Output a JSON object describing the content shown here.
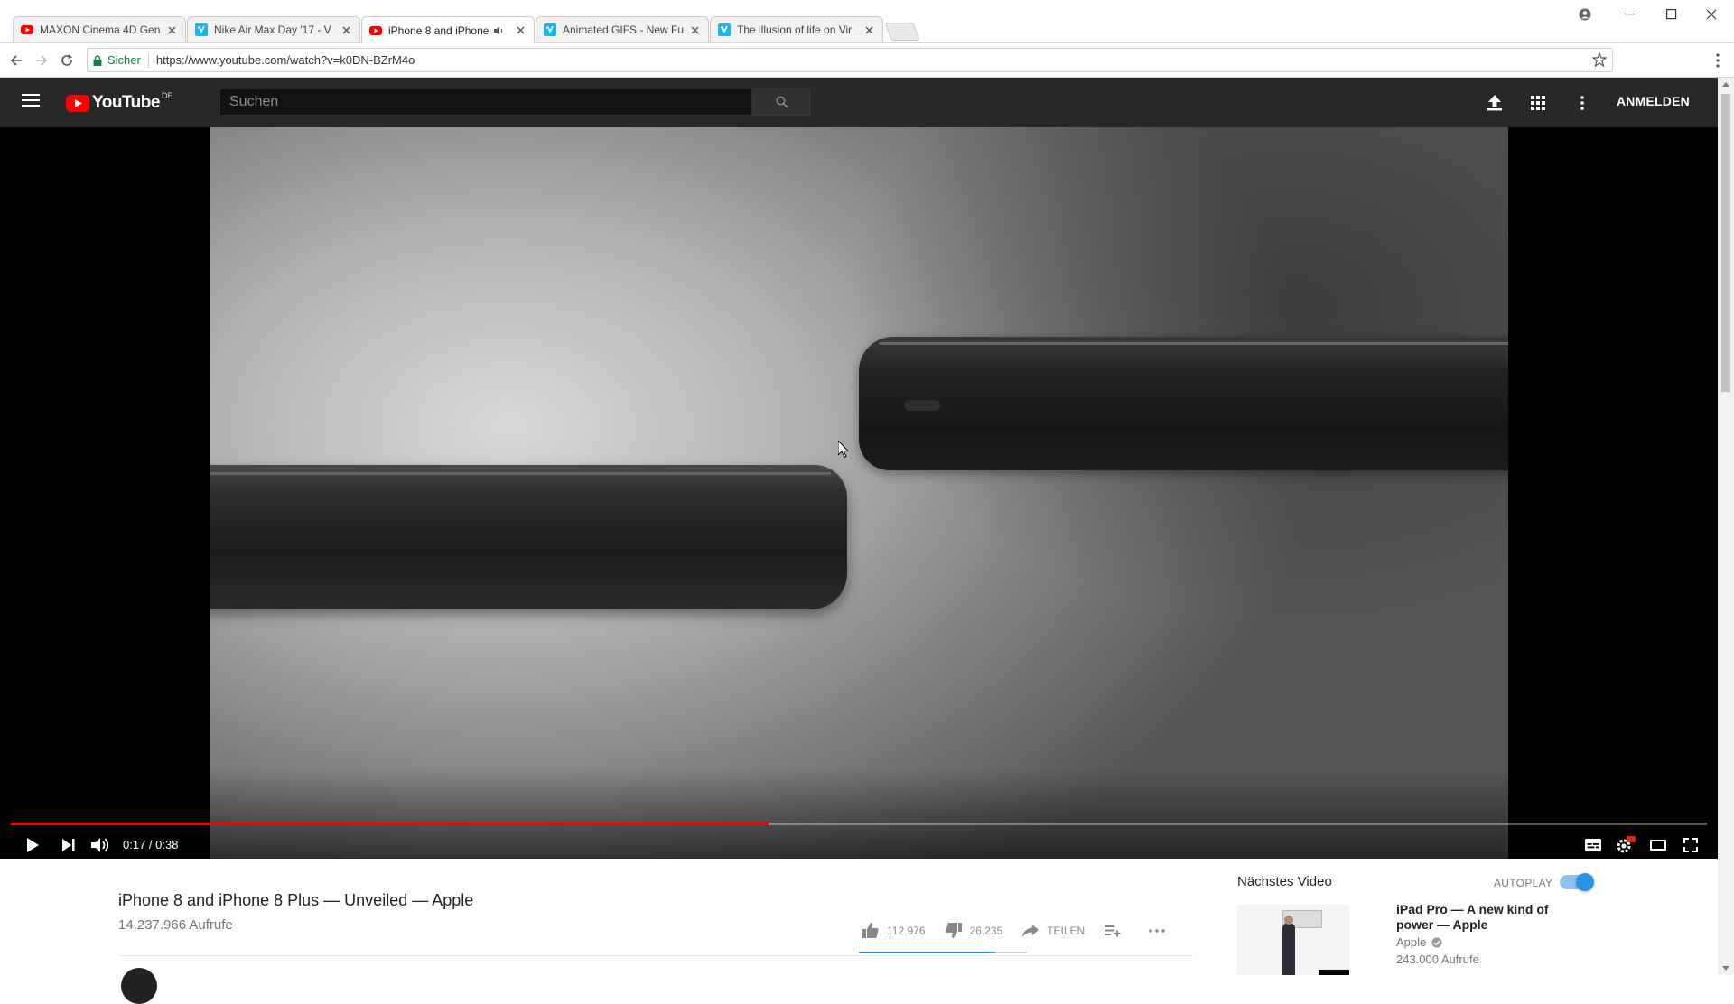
{
  "browser": {
    "tabs": [
      {
        "title": "MAXON Cinema 4D Gen",
        "favicon": "youtube-icon"
      },
      {
        "title": "Nike Air Max Day '17 - V",
        "favicon": "vimeo-icon"
      },
      {
        "title": "iPhone 8 and iPhone",
        "favicon": "youtube-icon",
        "active": true,
        "audio": true
      },
      {
        "title": "Animated GIFS - New Fu",
        "favicon": "vimeo-icon"
      },
      {
        "title": "The illusion of life on Vir",
        "favicon": "vimeo-icon"
      }
    ],
    "secure_label": "Sicher",
    "url": "https://www.youtube.com/watch?v=k0DN-BZrM4o"
  },
  "masthead": {
    "logo_text": "YouTube",
    "region": "DE",
    "search_placeholder": "Suchen",
    "signin_label": "ANMELDEN"
  },
  "player": {
    "current_time": "0:17",
    "duration": "0:38",
    "time_display": "0:17 / 0:38",
    "progress_fraction": 0.447
  },
  "video": {
    "title": "iPhone 8 and iPhone 8 Plus — Unveiled — Apple",
    "views": "14.237.966 Aufrufe",
    "likes": "112.976",
    "dislikes": "26.235",
    "share_label": "TEILEN",
    "like_fraction": 0.81
  },
  "sidebar": {
    "next_label": "Nächstes Video",
    "autoplay_label": "AUTOPLAY",
    "autoplay_on": true,
    "related": {
      "title": "iPad Pro — A new kind of power — Apple",
      "channel": "Apple",
      "views": "243.000 Aufrufe"
    }
  },
  "colors": {
    "youtube_red": "#ff0000",
    "masthead_bg": "#282828",
    "vimeo_blue": "#1ab7ea",
    "toggle_blue": "#2793e6"
  }
}
